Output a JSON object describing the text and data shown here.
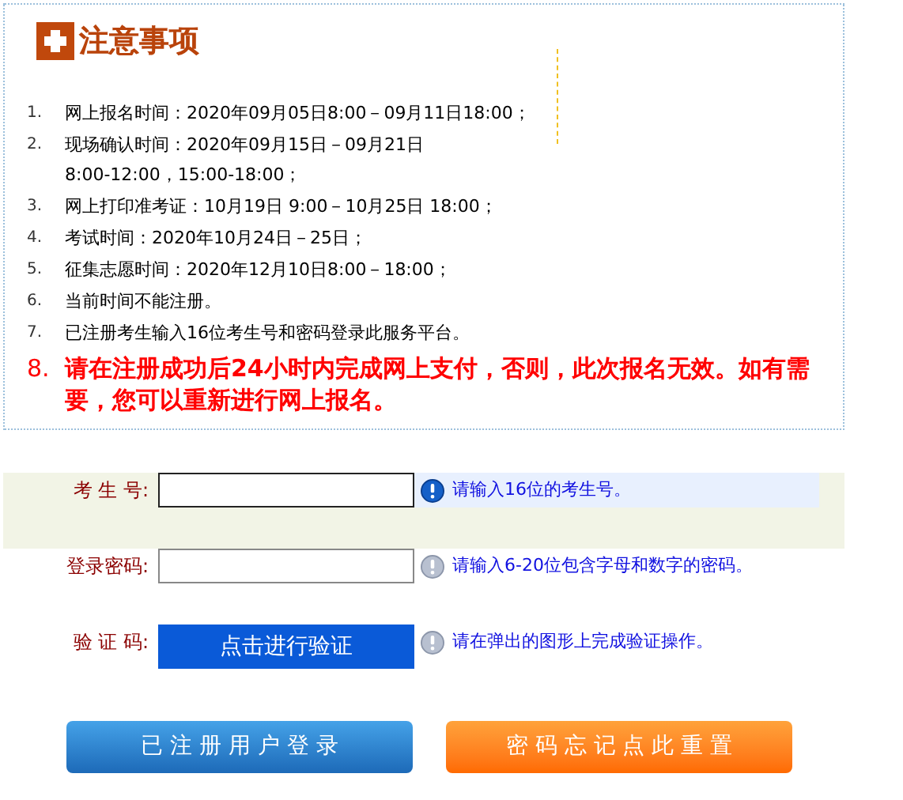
{
  "notice": {
    "title": "注意事项",
    "items": [
      {
        "number": "1.",
        "lines": [
          "网上报名时间：2020年09月05日8:00－09月11日18:00；"
        ],
        "emphasis": false
      },
      {
        "number": "2.",
        "lines": [
          "现场确认时间：2020年09月15日－09月21日",
          "8:00-12:00，15:00-18:00；"
        ],
        "emphasis": false
      },
      {
        "number": "3.",
        "lines": [
          "网上打印准考证：10月19日 9:00－10月25日 18:00；"
        ],
        "emphasis": false
      },
      {
        "number": "4.",
        "lines": [
          "考试时间：2020年10月24日－25日；"
        ],
        "emphasis": false
      },
      {
        "number": "5.",
        "lines": [
          "征集志愿时间：2020年12月10日8:00－18:00；"
        ],
        "emphasis": false
      },
      {
        "number": "6.",
        "lines": [
          "当前时间不能注册。"
        ],
        "emphasis": false
      },
      {
        "number": "7.",
        "lines": [
          "已注册考生输入16位考生号和密码登录此服务平台。"
        ],
        "emphasis": false
      },
      {
        "number": "8.",
        "lines": [
          "请在注册成功后24小时内完成网上支付，否则，此次报名无效。如有需要，您可以重新进行网上报名。"
        ],
        "emphasis": true
      }
    ]
  },
  "form": {
    "rows": [
      {
        "label": "考 生 号:",
        "kind": "input",
        "focused": true,
        "hint": "请输入16位的考生号。"
      },
      {
        "label": "登录密码:",
        "kind": "input",
        "focused": false,
        "hint": "请输入6-20位包含字母和数字的密码。"
      },
      {
        "label": "验 证 码:",
        "kind": "captcha",
        "button": "点击进行验证",
        "focused": false,
        "hint": "请在弹出的图形上完成验证操作。"
      }
    ]
  },
  "buttons": [
    {
      "label": "已 注 册 用 户 登 录",
      "kind": "primary"
    },
    {
      "label": "密 码 忘 记 点 此 重 置",
      "kind": "warning"
    }
  ]
}
